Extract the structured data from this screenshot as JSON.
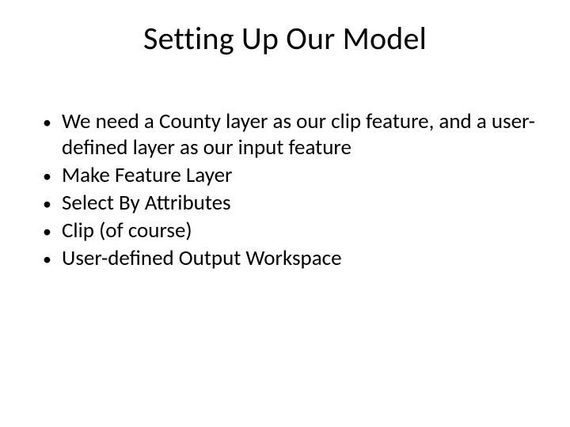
{
  "title": "Setting Up Our Model",
  "bullets": [
    "We need a County layer as our clip feature, and a user-defined layer as our input feature",
    "Make Feature Layer",
    "Select By Attributes",
    "Clip (of course)",
    "User-defined Output Workspace"
  ]
}
